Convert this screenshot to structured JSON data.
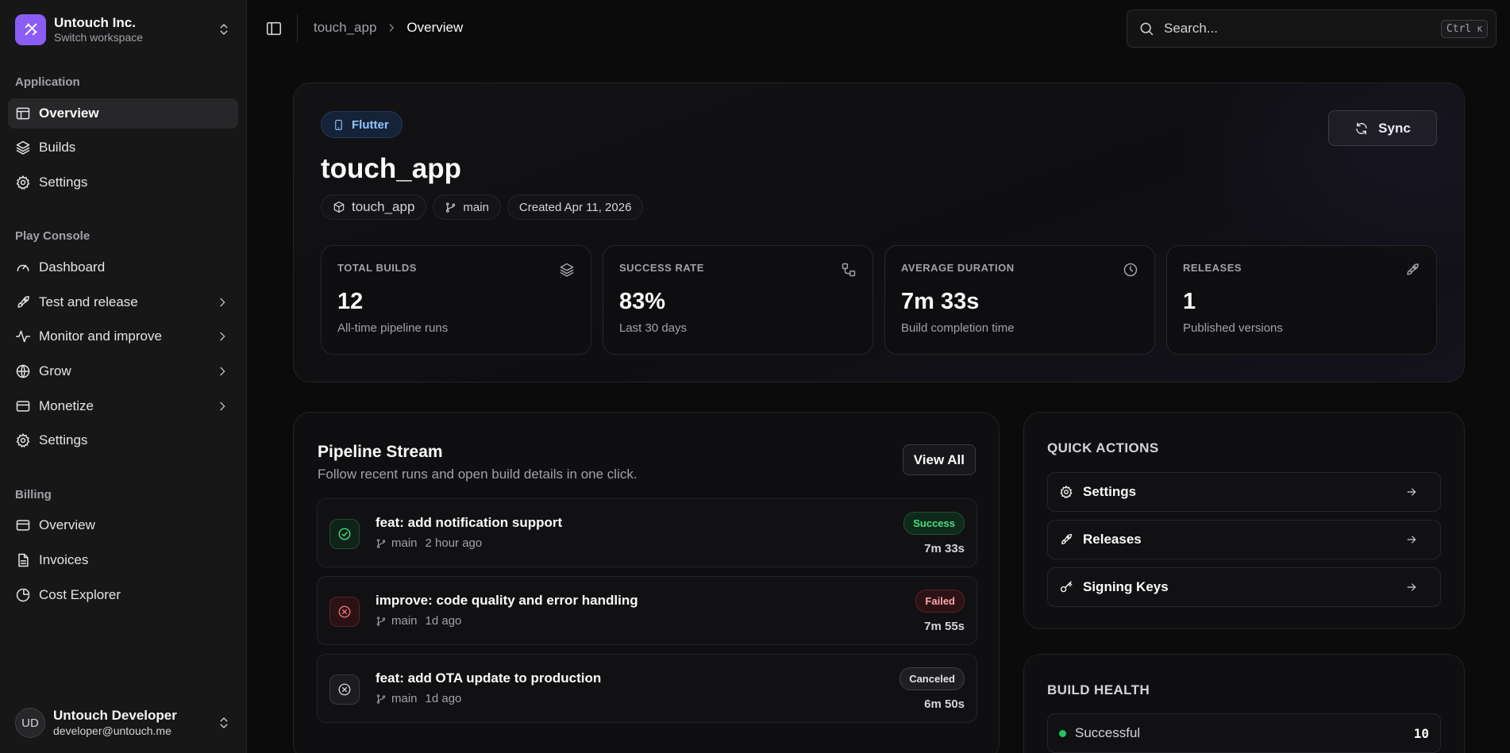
{
  "workspace": {
    "name": "Untouch Inc.",
    "subtitle": "Switch workspace"
  },
  "sidebar": {
    "groups": [
      {
        "label": "Application",
        "items": [
          {
            "label": "Overview",
            "icon": "layout-icon",
            "active": true
          },
          {
            "label": "Builds",
            "icon": "layers-icon"
          },
          {
            "label": "Settings",
            "icon": "gear-icon"
          }
        ]
      },
      {
        "label": "Play Console",
        "items": [
          {
            "label": "Dashboard",
            "icon": "gauge-icon"
          },
          {
            "label": "Test and release",
            "icon": "rocket-icon",
            "expandable": true
          },
          {
            "label": "Monitor and improve",
            "icon": "activity-icon",
            "expandable": true
          },
          {
            "label": "Grow",
            "icon": "globe-icon",
            "expandable": true
          },
          {
            "label": "Monetize",
            "icon": "card-icon",
            "expandable": true
          },
          {
            "label": "Settings",
            "icon": "gear-icon"
          }
        ]
      },
      {
        "label": "Billing",
        "items": [
          {
            "label": "Overview",
            "icon": "card-icon"
          },
          {
            "label": "Invoices",
            "icon": "file-icon"
          },
          {
            "label": "Cost Explorer",
            "icon": "pie-icon"
          }
        ]
      }
    ]
  },
  "user": {
    "initials": "UD",
    "name": "Untouch Developer",
    "email": "developer@untouch.me"
  },
  "breadcrumb": {
    "parent": "touch_app",
    "current": "Overview"
  },
  "search": {
    "placeholder": "Search...",
    "shortcut_main": "Ctrl",
    "shortcut_key": "K"
  },
  "app": {
    "platform": "Flutter",
    "title": "touch_app",
    "package": "touch_app",
    "branch": "main",
    "created": "Created Apr 11, 2026",
    "sync_label": "Sync"
  },
  "stats": [
    {
      "label": "TOTAL BUILDS",
      "value": "12",
      "sub": "All-time pipeline runs",
      "icon": "layers-icon"
    },
    {
      "label": "SUCCESS RATE",
      "value": "83%",
      "sub": "Last 30 days",
      "icon": "workflow-icon"
    },
    {
      "label": "AVERAGE DURATION",
      "value": "7m 33s",
      "sub": "Build completion time",
      "icon": "clock-icon"
    },
    {
      "label": "RELEASES",
      "value": "1",
      "sub": "Published versions",
      "icon": "rocket-icon"
    }
  ],
  "pipeline": {
    "title": "Pipeline Stream",
    "subtitle": "Follow recent runs and open build details in one click.",
    "view_all": "View All",
    "runs": [
      {
        "title": "feat: add notification support",
        "branch": "main",
        "time": "2 hour ago",
        "status": "Success",
        "duration": "7m 33s"
      },
      {
        "title": "improve: code quality and error handling",
        "branch": "main",
        "time": "1d ago",
        "status": "Failed",
        "duration": "7m 55s"
      },
      {
        "title": "feat: add OTA update to production",
        "branch": "main",
        "time": "1d ago",
        "status": "Canceled",
        "duration": "6m 50s"
      }
    ]
  },
  "quick_actions": {
    "title": "QUICK ACTIONS",
    "items": [
      {
        "label": "Settings",
        "icon": "gear-icon"
      },
      {
        "label": "Releases",
        "icon": "rocket-icon"
      },
      {
        "label": "Signing Keys",
        "icon": "key-icon"
      }
    ]
  },
  "build_health": {
    "title": "BUILD HEALTH",
    "rows": [
      {
        "label": "Successful",
        "value": "10"
      }
    ]
  },
  "colors": {
    "accent": "#8b5cf6",
    "success": "#4ade80",
    "failed": "#f87171",
    "info": "#93c5fd"
  }
}
